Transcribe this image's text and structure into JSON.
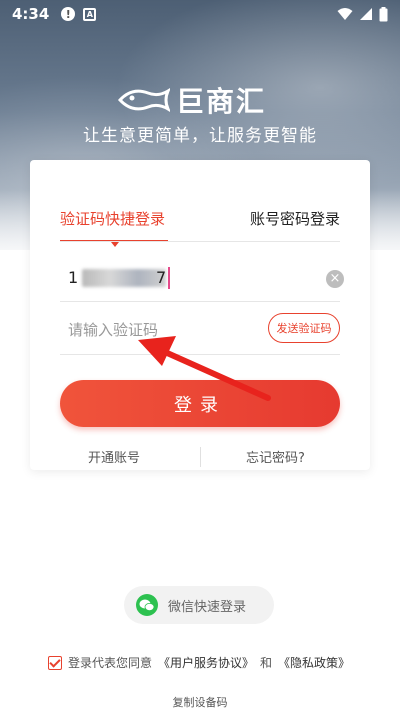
{
  "status_bar": {
    "time": "4:34",
    "alert_icon": "!",
    "a_icon": "A"
  },
  "brand": {
    "name": "巨商汇",
    "tagline": "让生意更简单，让服务更智能"
  },
  "tabs": {
    "sms_login": "验证码快捷登录",
    "password_login": "账号密码登录",
    "active": "sms_login"
  },
  "phone_field": {
    "value_visible_start": "1",
    "value_visible_end": "7",
    "clear_icon": "×"
  },
  "code_field": {
    "placeholder": "请输入验证码",
    "value": ""
  },
  "send_code_button": "发送验证码",
  "login_button": "登录",
  "links": {
    "open_account": "开通账号",
    "forgot_password": "忘记密码?"
  },
  "wechat_login": "微信快速登录",
  "agreement": {
    "prefix": "登录代表您同意",
    "user_agreement": "《用户服务协议》",
    "and": "和",
    "privacy_policy": "《隐私政策》",
    "checked": true
  },
  "copy_device_code": "复制设备码",
  "colors": {
    "accent": "#e8422e",
    "wechat_green": "#2dc150"
  }
}
